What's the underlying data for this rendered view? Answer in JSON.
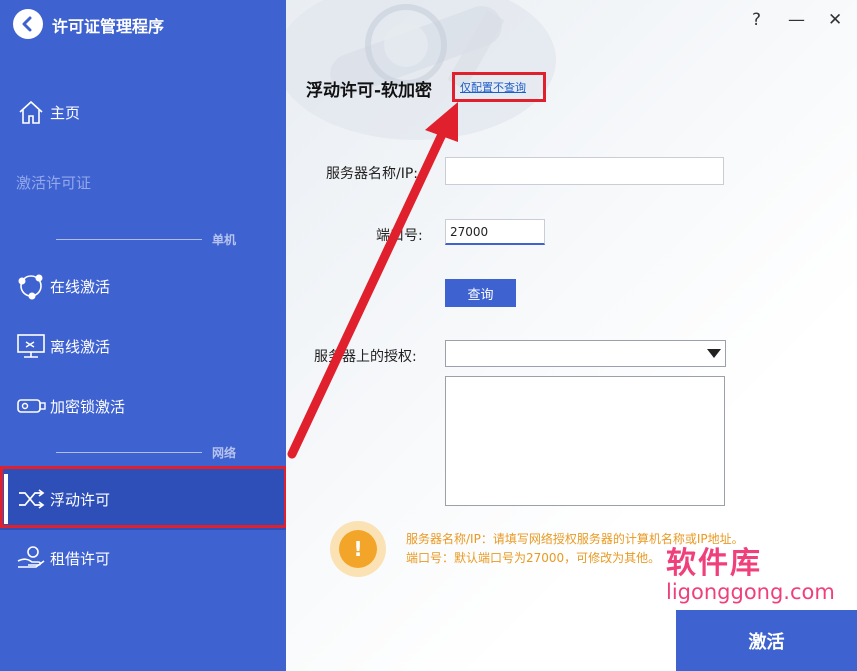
{
  "app": {
    "title": "许可证管理程序"
  },
  "sidebar": {
    "home": "主页",
    "activate_license": "激活许可证",
    "section_single": "单机",
    "online_activation": "在线激活",
    "offline_activation": "离线激活",
    "dongle_activation": "加密锁激活",
    "section_network": "网络",
    "floating_license": "浮动许可",
    "borrow_license": "租借许可"
  },
  "window": {
    "help": "?",
    "minimize": "—",
    "close": "✕"
  },
  "main": {
    "title": "浮动许可-软加密",
    "config_link": "仅配置不查询",
    "server_label": "服务器名称/IP:",
    "server_value": "",
    "port_label": "端口号:",
    "port_value": "27000",
    "query_button": "查询",
    "license_label": "服务器上的授权:",
    "license_selected": "",
    "hint_line1": "服务器名称/IP：请填写网络授权服务器的计算机名称或IP地址。",
    "hint_line2": "端口号：默认端口号为27000，可修改为其他。",
    "activate_button": "激活"
  },
  "watermark": {
    "cn": "软件库",
    "en": "ligonggong.com"
  },
  "colors": {
    "sidebar": "#3f62d1",
    "active": "#2e4fb8",
    "highlight": "#e0202d",
    "hint": "#e99a23"
  }
}
